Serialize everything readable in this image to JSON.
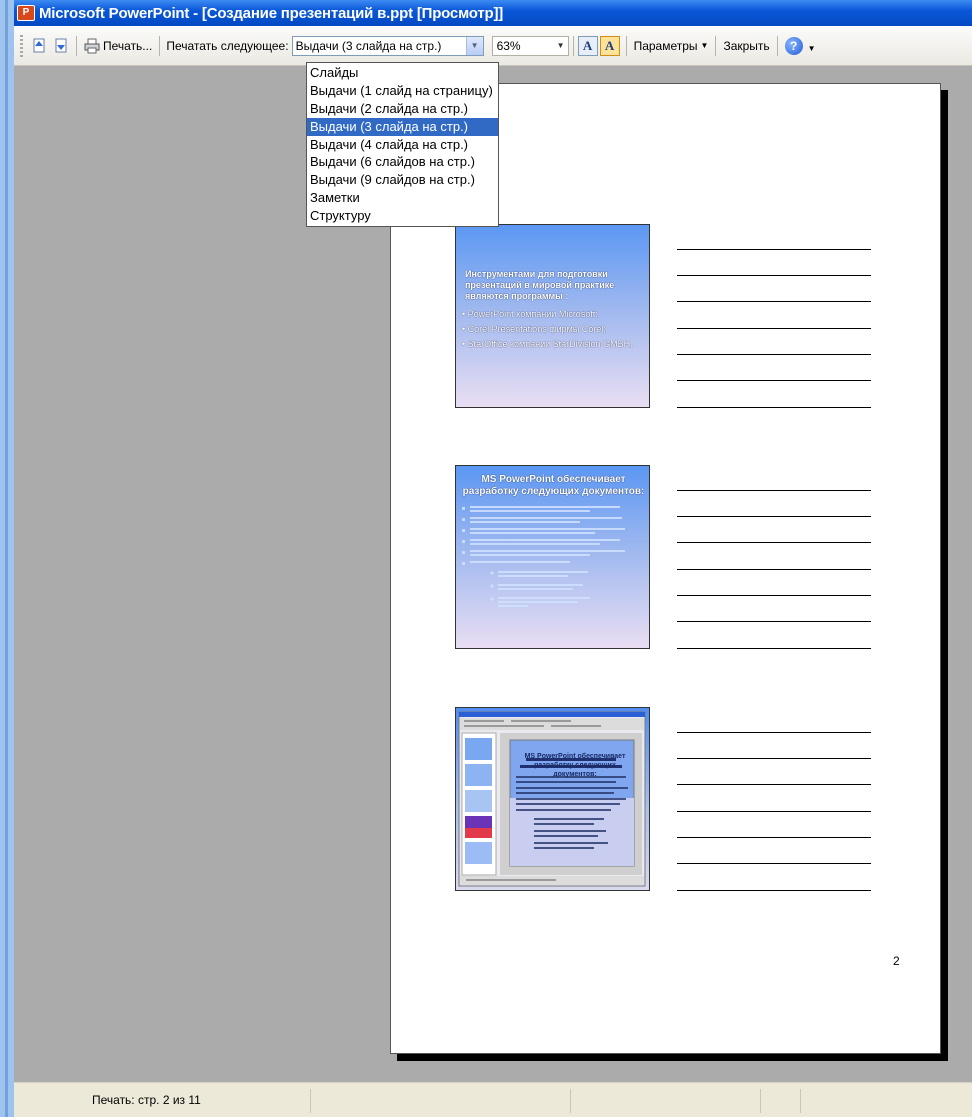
{
  "window": {
    "title": "Microsoft PowerPoint - [Создание презентаций в.ppt [Просмотр]]",
    "app_icon": "P"
  },
  "toolbar": {
    "print_label": "Печать...",
    "print_next_label": "Печатать следующее:",
    "print_what_value": "Выдачи (3 слайда на стр.)",
    "zoom_value": "63%",
    "params_label": "Параметры",
    "close_label": "Закрыть",
    "grayscale_glyph": "A",
    "color_glyph": "A",
    "help_glyph": "?"
  },
  "dropdown": {
    "options": [
      "Слайды",
      "Выдачи (1 слайд на страницу)",
      "Выдачи (2 слайда на стр.)",
      "Выдачи (3 слайда на стр.)",
      "Выдачи (4 слайда на стр.)",
      "Выдачи (6 слайдов на стр.)",
      "Выдачи (9 слайдов на стр.)",
      "Заметки",
      "Структуру"
    ],
    "selected_index": 3
  },
  "page": {
    "page_number": "2",
    "slide1": {
      "heading": "Инструментами для подготовки презентаций в мировой практике являются программы :",
      "bullets": [
        "PowerPoint компании Microsoft;",
        "Corel Presentations фирмы Corel;",
        "StarOffice компании StarDivision GMBH."
      ]
    },
    "slide2": {
      "heading": "MS PowerPoint обеспечивает разработку следующих документов:"
    },
    "slide3": {
      "heading": "MS PowerPoint обеспечивает разработку следующих документов:"
    }
  },
  "status": {
    "text": "Печать: стр. 2 из 11"
  }
}
